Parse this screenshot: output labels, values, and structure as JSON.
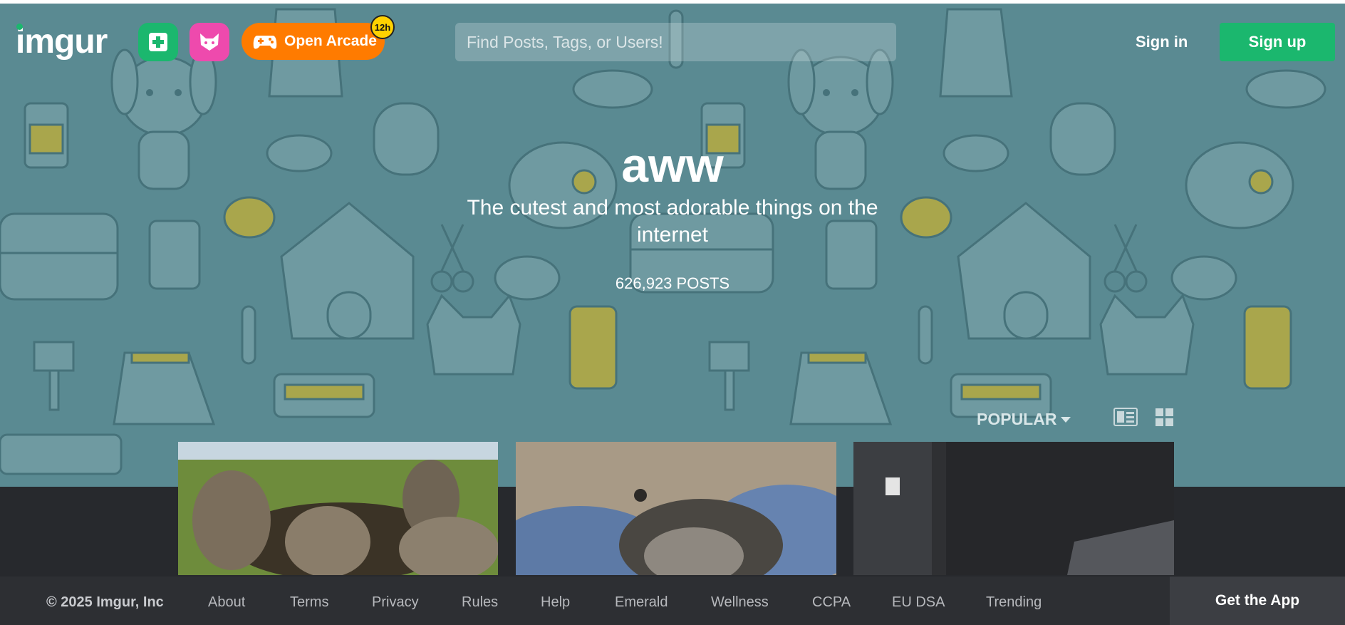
{
  "header": {
    "logo_text": "imgur",
    "arcade_label": "Open Arcade",
    "arcade_badge": "12h",
    "search_placeholder": "Find Posts, Tags, or Users!",
    "signin_label": "Sign in",
    "signup_label": "Sign up"
  },
  "hero": {
    "title": "aww",
    "subtitle": "The cutest and most adorable things on the internet",
    "post_count": "626,923 POSTS"
  },
  "sort": {
    "label": "POPULAR"
  },
  "footer": {
    "copyright": "© 2025 Imgur, Inc",
    "links": [
      "About",
      "Terms",
      "Privacy",
      "Rules",
      "Help",
      "Emerald",
      "Wellness",
      "CCPA",
      "EU DSA",
      "Trending"
    ],
    "get_app": "Get the App"
  },
  "colors": {
    "hero_bg": "#5a8a92",
    "green": "#1bb76e",
    "pink": "#ee4aad",
    "orange": "#ff7b00",
    "footer_bg": "#2d2f33"
  },
  "icons": {
    "new_post": "plus-square-icon",
    "meme": "cat-face-icon",
    "arcade": "gamepad-icon",
    "sort": "caret-down-icon",
    "view_detailed": "detailed-view-icon",
    "view_grid": "grid-view-icon"
  }
}
